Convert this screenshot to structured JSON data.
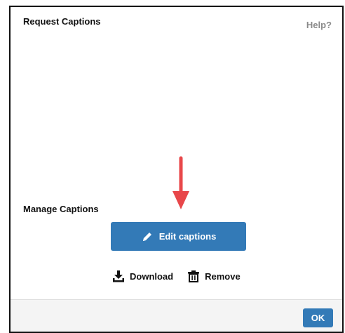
{
  "dialog": {
    "title": "Request Captions",
    "help_label": "Help?"
  },
  "manage": {
    "section_label": "Manage Captions",
    "edit_label": "Edit captions",
    "edit_icon": "pencil-icon",
    "download_label": "Download",
    "download_icon": "download-icon",
    "remove_label": "Remove",
    "remove_icon": "trash-icon"
  },
  "annotation": {
    "arrow_icon": "arrow-down-icon",
    "arrow_color": "#e8474a"
  },
  "footer": {
    "ok_label": "OK"
  },
  "colors": {
    "primary_button": "#337ab7",
    "help_text": "#8a8a8a",
    "footer_bg": "#f4f4f4"
  }
}
